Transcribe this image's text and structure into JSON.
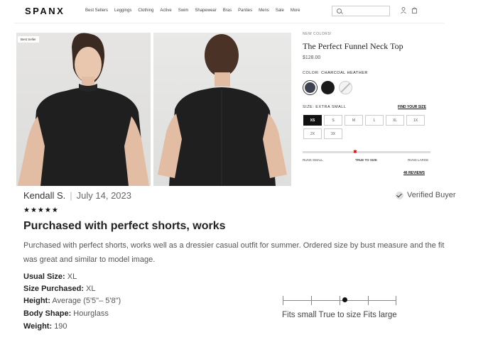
{
  "header": {
    "logo": "SPANX",
    "nav": [
      "Best Sellers",
      "Leggings",
      "Clothing",
      "Active",
      "Swim",
      "Shapewear",
      "Bras",
      "Panties",
      "Mens",
      "Sale",
      "More"
    ]
  },
  "product": {
    "badge": "Best Seller",
    "new_colors": "NEW COLORS!",
    "title": "The Perfect Funnel Neck Top",
    "price": "$128.00",
    "color_label": "COLOR:",
    "color_value": "CHARCOAL HEATHER",
    "swatches": [
      {
        "name": "charcoal-heather",
        "color": "#3c4250"
      },
      {
        "name": "black",
        "color": "#1a1a1a"
      },
      {
        "name": "white",
        "color": "#f4f4f4"
      }
    ],
    "size_label": "SIZE:",
    "size_value": "EXTRA SMALL",
    "find_your_size": "FIND YOUR SIZE",
    "sizes_row1": [
      "XS",
      "S",
      "M",
      "L",
      "XL",
      "1X"
    ],
    "sizes_row2": [
      "2X",
      "3X"
    ],
    "selected_size": "XS",
    "fit_labels": [
      "RUNS SMALL",
      "TRUE TO SIZE",
      "RUNS LARGE"
    ],
    "fit_position": 0.4,
    "reviews_link": "46 REVIEWS"
  },
  "review": {
    "name": "Kendall S.",
    "date": "July 14, 2023",
    "verified": "Verified Buyer",
    "stars": "★★★★★",
    "rating": 5,
    "title": "Purchased with perfect shorts, works",
    "body": "Purchased with perfect shorts, works well as a dressier casual outfit for summer. Ordered size by bust measure and the fit was great and similar to model image.",
    "attributes": [
      {
        "label": "Usual Size:",
        "value": "XL"
      },
      {
        "label": "Size Purchased:",
        "value": "XL"
      },
      {
        "label": "Height:",
        "value": "Average (5'5\"– 5'8\")"
      },
      {
        "label": "Body Shape:",
        "value": "Hourglass"
      },
      {
        "label": "Weight:",
        "value": "190"
      }
    ],
    "fit_scale_labels": "Fits small True to size Fits large",
    "fit_scale_value": 0.5
  }
}
